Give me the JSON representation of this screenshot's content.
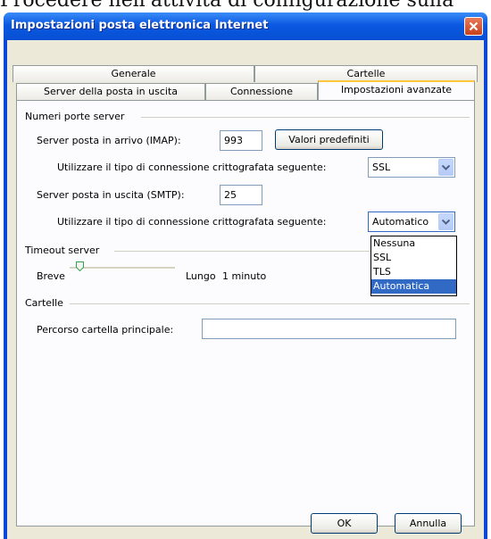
{
  "page": {
    "top_text": "Procedere nell'attività di configurazione sulla"
  },
  "window": {
    "title": "Impostazioni posta elettronica Internet"
  },
  "tabs": {
    "row1": [
      "Generale",
      "Cartelle"
    ],
    "row2": [
      "Server della posta in uscita",
      "Connessione",
      "Impostazioni avanzate"
    ],
    "active": "Impostazioni avanzate"
  },
  "ports": {
    "group_label": "Numeri porte server",
    "imap_label": "Server posta in arrivo (IMAP):",
    "imap_value": "993",
    "defaults_button": "Valori predefiniti",
    "encryption_label_1": "Utilizzare il tipo di connessione crittografata seguente:",
    "encryption_value_1": "SSL",
    "smtp_label": "Server posta in uscita (SMTP):",
    "smtp_value": "25",
    "encryption_label_2": "Utilizzare il tipo di connessione crittografata seguente:",
    "encryption_value_2": "Automatico",
    "encryption_options": [
      "Nessuna",
      "SSL",
      "TLS",
      "Automatica"
    ],
    "encryption_selected_option": "Automatica"
  },
  "timeout": {
    "group_label": "Timeout server",
    "short_label": "Breve",
    "long_label": "Lungo",
    "value_text": "1 minuto",
    "slider_fraction": 0.06
  },
  "folders": {
    "group_label": "Cartelle",
    "root_path_label": "Percorso cartella principale:",
    "root_path_value": ""
  },
  "buttons": {
    "ok": "OK",
    "cancel": "Annulla"
  },
  "colors": {
    "titlebar": "#0a58e0",
    "dialog_bg": "#ece9d8",
    "tab_highlight": "#ffc83c",
    "selection": "#316ac5"
  }
}
